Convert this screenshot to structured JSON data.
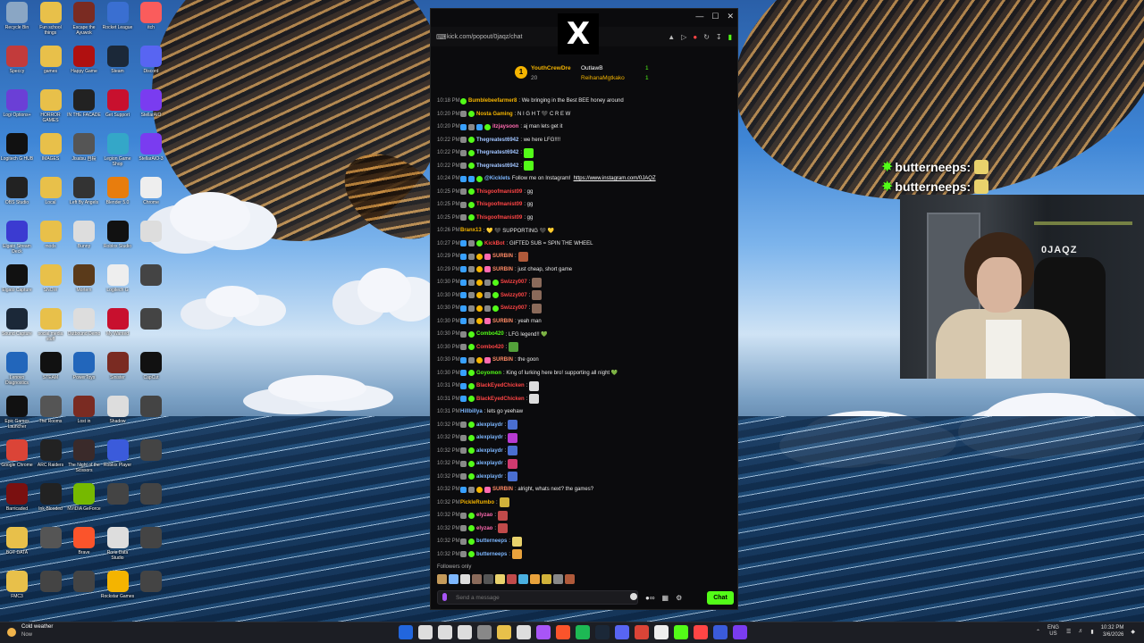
{
  "colors": {
    "kick_green": "#53fc18",
    "chat_bg": "#0b0b0d",
    "gold": "#f4b400"
  },
  "desktop_icons": [
    {
      "label": "Recycle Bin",
      "color": "#8aa6c4"
    },
    {
      "label": "Fun school things",
      "color": "#e8c04a"
    },
    {
      "label": "Escape the Ayuwok",
      "color": "#7a2b22"
    },
    {
      "label": "Rocket League",
      "color": "#3a6fd1"
    },
    {
      "label": "itch",
      "color": "#fa5c5c"
    },
    {
      "label": "Speccy",
      "color": "#c23b3b"
    },
    {
      "label": "games",
      "color": "#e8c04a"
    },
    {
      "label": "Happy Game",
      "color": "#b01010"
    },
    {
      "label": "Steam",
      "color": "#1b2838"
    },
    {
      "label": "Discord",
      "color": "#5865f2"
    },
    {
      "label": "Logi Options+",
      "color": "#6b3fd6"
    },
    {
      "label": "HORROR GAMES",
      "color": "#e8c04a"
    },
    {
      "label": "IN THE FACADE",
      "color": "#222"
    },
    {
      "label": "Get Support",
      "color": "#c8102e"
    },
    {
      "label": "StellarAIO",
      "color": "#7a3cf0"
    },
    {
      "label": "Logitech G HUB",
      "color": "#111"
    },
    {
      "label": "IMAGES",
      "color": "#e8c04a"
    },
    {
      "label": "Jisatsu 自殺",
      "color": "#555"
    },
    {
      "label": "Legion Game Shop",
      "color": "#34a7c8"
    },
    {
      "label": "StellarAIO-3",
      "color": "#7a3cf0"
    },
    {
      "label": "OBS Studio",
      "color": "#222"
    },
    {
      "label": "Local",
      "color": "#e8c04a"
    },
    {
      "label": "Left By Angels",
      "color": "#333"
    },
    {
      "label": "Blender 5.0",
      "color": "#e87d0d"
    },
    {
      "label": "Chrome",
      "color": "#eee"
    },
    {
      "label": "Elgato Stream Deck",
      "color": "#3b3bd1"
    },
    {
      "label": "mods",
      "color": "#e8c04a"
    },
    {
      "label": "Bunny",
      "color": "#ddd"
    },
    {
      "label": "Roblox Studio",
      "color": "#111"
    },
    {
      "label": "",
      "color": "#ddd"
    },
    {
      "label": "Elgato Capture",
      "color": "#111"
    },
    {
      "label": "SNOW",
      "color": "#e8c04a"
    },
    {
      "label": "Mortem",
      "color": "#5a3a1a"
    },
    {
      "label": "Logitech G",
      "color": "#eee"
    },
    {
      "label": "",
      "color": "#444"
    },
    {
      "label": "Sound Capture",
      "color": "#1b2838"
    },
    {
      "label": "social media stuff",
      "color": "#e8c04a"
    },
    {
      "label": "Outbound Demo",
      "color": "#ddd"
    },
    {
      "label": "My Wanted",
      "color": "#c8102e"
    },
    {
      "label": "",
      "color": "#444"
    },
    {
      "label": "Lenovo Diagnostics",
      "color": "#2266bb"
    },
    {
      "label": "STEAM",
      "color": "#111"
    },
    {
      "label": "PowerToys",
      "color": "#2266bb"
    },
    {
      "label": "Sinister",
      "color": "#7a2b22"
    },
    {
      "label": "CapCut",
      "color": "#111"
    },
    {
      "label": "Epic Games Launcher",
      "color": "#111"
    },
    {
      "label": "The Rooms",
      "color": "#555"
    },
    {
      "label": "Lost in",
      "color": "#7a2b22"
    },
    {
      "label": "Shadow",
      "color": "#ddd"
    },
    {
      "label": "",
      "color": "#444"
    },
    {
      "label": "Google Chrome",
      "color": "#db4437"
    },
    {
      "label": "ARC Raiders",
      "color": "#222"
    },
    {
      "label": "The Night of the Scissors",
      "color": "#3a2a2a"
    },
    {
      "label": "Roblox Player",
      "color": "#3b5bdb"
    },
    {
      "label": "",
      "color": "#444"
    },
    {
      "label": "Barricaded",
      "color": "#7a1010"
    },
    {
      "label": "Ink-Blooded",
      "color": "#222"
    },
    {
      "label": "NVIDIA GeForce",
      "color": "#76b900"
    },
    {
      "label": "",
      "color": "#444"
    },
    {
      "label": "",
      "color": "#444"
    },
    {
      "label": "BOT DATA",
      "color": "#e8c04a"
    },
    {
      "label": "",
      "color": "#555"
    },
    {
      "label": "Brave",
      "color": "#fb542b"
    },
    {
      "label": "Roris Data Studio",
      "color": "#ddd"
    },
    {
      "label": "",
      "color": "#444"
    },
    {
      "label": "FMC3",
      "color": "#e8c04a"
    },
    {
      "label": "",
      "color": "#444"
    },
    {
      "label": "",
      "color": "#444"
    },
    {
      "label": "Rockstar Games",
      "color": "#f4b400"
    },
    {
      "label": "",
      "color": "#444"
    }
  ],
  "browser": {
    "url": "kick.com/popout/0jaqz/chat",
    "x_logo": "X"
  },
  "pinned": {
    "rank": "1",
    "top_user": "YouthCrewDre",
    "top_count": "20",
    "user2": "OutlawB",
    "user2_count": "1",
    "user3": "ReihanaMgtkako",
    "user3_count": "1"
  },
  "messages": [
    {
      "time": "10:18 PM",
      "badges": [
        "green"
      ],
      "user": "Bumblebeefarmer8",
      "color": "#f4b400",
      "text": ": We bringing in the Best BEE honey around",
      "emotes": []
    },
    {
      "time": "10:20 PM",
      "badges": [
        "grey",
        "green"
      ],
      "user": "Nosta Gaming",
      "color": "#f4b400",
      "text": ": N I G H T 🖤 C R E W",
      "emotes": []
    },
    {
      "time": "10:20 PM",
      "badges": [
        "blue",
        "grey",
        "blue",
        "green"
      ],
      "user": "itzjaysoon",
      "color": "#ff6ab0",
      "text": ": aj man lets get it",
      "emotes": []
    },
    {
      "time": "10:22 PM",
      "badges": [
        "grey",
        "green"
      ],
      "user": "Thegreatest6942",
      "color": "#a0c4ff",
      "text": ": we here LFG!!!!",
      "emotes": []
    },
    {
      "time": "10:22 PM",
      "badges": [
        "grey",
        "green"
      ],
      "user": "Thegreatest6942",
      "color": "#a0c4ff",
      "text": ":",
      "emotes": [
        "#53fc18"
      ]
    },
    {
      "time": "10:22 PM",
      "badges": [
        "grey",
        "green"
      ],
      "user": "Thegreatest6942",
      "color": "#a0c4ff",
      "text": ":",
      "emotes": [
        "#53fc18"
      ]
    },
    {
      "time": "10:24 PM",
      "badges": [
        "blue",
        "blue",
        "green"
      ],
      "user": "@Kicklets",
      "color": "#7db7ff",
      "text": " Follow me on Instagram!",
      "link": "https://www.instagram.com/0JAQZ",
      "emotes": []
    },
    {
      "time": "10:25 PM",
      "badges": [
        "grey",
        "green"
      ],
      "user": "Thisgoofmanist09",
      "color": "#ff4545",
      "text": ": gg",
      "emotes": []
    },
    {
      "time": "10:25 PM",
      "badges": [
        "grey",
        "green"
      ],
      "user": "Thisgoofmanist09",
      "color": "#ff4545",
      "text": ": gg",
      "emotes": []
    },
    {
      "time": "10:25 PM",
      "badges": [
        "grey",
        "green"
      ],
      "user": "Thisgoofmanist09",
      "color": "#ff4545",
      "text": ": gg",
      "emotes": []
    },
    {
      "time": "10:26 PM",
      "badges": [],
      "user": "Branx13",
      "color": "#f4b400",
      "text": ": 💛 🖤 SUPPORTING 🖤 💛",
      "emotes": []
    },
    {
      "time": "10:27 PM",
      "badges": [
        "blue",
        "grey",
        "green"
      ],
      "user": "KickBot",
      "color": "#ff4545",
      "text": ": GIFTED SUB = SPIN THE WHEEL",
      "emotes": []
    },
    {
      "time": "10:29 PM",
      "badges": [
        "blue",
        "grey",
        "orange",
        "pink"
      ],
      "user": "SURBIN",
      "color": "#ff8a65",
      "text": ":",
      "emotes": [
        "#b05a3a"
      ]
    },
    {
      "time": "10:29 PM",
      "badges": [
        "blue",
        "grey",
        "orange",
        "pink"
      ],
      "user": "SURBIN",
      "color": "#ff8a65",
      "text": ": just cheap, short game",
      "emotes": []
    },
    {
      "time": "10:30 PM",
      "badges": [
        "blue",
        "grey",
        "orange",
        "grey",
        "green"
      ],
      "user": "Swizzy007",
      "color": "#ff4545",
      "text": ":",
      "emotes": [
        "#8a6a5a"
      ]
    },
    {
      "time": "10:30 PM",
      "badges": [
        "blue",
        "grey",
        "orange",
        "grey",
        "green"
      ],
      "user": "Swizzy007",
      "color": "#ff4545",
      "text": ":",
      "emotes": [
        "#8a6a5a"
      ]
    },
    {
      "time": "10:30 PM",
      "badges": [
        "blue",
        "grey",
        "orange",
        "grey",
        "green"
      ],
      "user": "Swizzy007",
      "color": "#ff4545",
      "text": ":",
      "emotes": [
        "#8a6a5a"
      ]
    },
    {
      "time": "10:30 PM",
      "badges": [
        "blue",
        "grey",
        "orange",
        "pink"
      ],
      "user": "SURBIN",
      "color": "#ff8a65",
      "text": ": yeah man",
      "emotes": []
    },
    {
      "time": "10:30 PM",
      "badges": [
        "grey",
        "green"
      ],
      "user": "Combo420",
      "color": "#53fc18",
      "text": ": LFG legend!! 💚",
      "emotes": []
    },
    {
      "time": "10:30 PM",
      "badges": [
        "grey",
        "green"
      ],
      "user": "Combo420",
      "color": "#ff4545",
      "text": ":",
      "emotes": [
        "#53a03a"
      ]
    },
    {
      "time": "10:30 PM",
      "badges": [
        "blue",
        "grey",
        "orange",
        "pink"
      ],
      "user": "SURBIN",
      "color": "#ff8a65",
      "text": ": the goon",
      "emotes": []
    },
    {
      "time": "10:30 PM",
      "badges": [
        "blue",
        "green"
      ],
      "user": "Goyomon",
      "color": "#53fc18",
      "text": ": King of lurking here bro! supporting all night 💚",
      "emotes": []
    },
    {
      "time": "10:31 PM",
      "badges": [
        "blue",
        "green"
      ],
      "user": "BlackEyedChicken",
      "color": "#ff4545",
      "text": ":",
      "emotes": [
        "#ddd"
      ]
    },
    {
      "time": "10:31 PM",
      "badges": [
        "blue",
        "green"
      ],
      "user": "BlackEyedChicken",
      "color": "#ff4545",
      "text": ":",
      "emotes": [
        "#ddd"
      ]
    },
    {
      "time": "10:31 PM",
      "badges": [],
      "user": "Hillbillya",
      "color": "#7db7ff",
      "text": ": lets go yeehaw",
      "emotes": []
    },
    {
      "time": "10:32 PM",
      "badges": [
        "grey",
        "green"
      ],
      "user": "alexplaydr",
      "color": "#7db7ff",
      "text": ":",
      "emotes": [
        "#4a6fd1"
      ]
    },
    {
      "time": "10:32 PM",
      "badges": [
        "grey",
        "green"
      ],
      "user": "alexplaydr",
      "color": "#7db7ff",
      "text": ":",
      "emotes": [
        "#b83ad1"
      ]
    },
    {
      "time": "10:32 PM",
      "badges": [
        "grey",
        "green"
      ],
      "user": "alexplaydr",
      "color": "#7db7ff",
      "text": ":",
      "emotes": [
        "#4a6fd1"
      ]
    },
    {
      "time": "10:32 PM",
      "badges": [
        "grey",
        "green"
      ],
      "user": "alexplaydr",
      "color": "#7db7ff",
      "text": ":",
      "emotes": [
        "#d13a6f"
      ]
    },
    {
      "time": "10:32 PM",
      "badges": [
        "grey",
        "green"
      ],
      "user": "alexplaydr",
      "color": "#7db7ff",
      "text": ":",
      "emotes": [
        "#4a6fd1"
      ]
    },
    {
      "time": "10:32 PM",
      "badges": [
        "blue",
        "grey",
        "orange",
        "pink"
      ],
      "user": "SURBIN",
      "color": "#ff8a65",
      "text": ": alright, whats next? the games?",
      "emotes": []
    },
    {
      "time": "10:32 PM",
      "badges": [],
      "user": "PickleRumbo",
      "color": "#f4b400",
      "text": ":",
      "emotes": [
        "#d1b23a"
      ]
    },
    {
      "time": "10:32 PM",
      "badges": [
        "grey",
        "green"
      ],
      "user": "elyzao",
      "color": "#ff6ab0",
      "text": ":",
      "emotes": [
        "#c04a4a"
      ]
    },
    {
      "time": "10:32 PM",
      "badges": [
        "grey",
        "green"
      ],
      "user": "elyzao",
      "color": "#ff6ab0",
      "text": ":",
      "emotes": [
        "#c04a4a"
      ]
    },
    {
      "time": "10:32 PM",
      "badges": [
        "grey",
        "green"
      ],
      "user": "butterneeps",
      "color": "#7db7ff",
      "text": ":",
      "emotes": [
        "#e9d26c"
      ]
    },
    {
      "time": "10:32 PM",
      "badges": [
        "grey",
        "green"
      ],
      "user": "butterneeps",
      "color": "#7db7ff",
      "text": ":",
      "emotes": [
        "#e9a23c"
      ]
    }
  ],
  "chat_footer": {
    "followers_only": "Followers only",
    "placeholder": "Send a message",
    "chat_button": "Chat",
    "emote_colors": [
      "#c49a5a",
      "#7db7ff",
      "#ddd",
      "#8a6a5a",
      "#555",
      "#e9d26c",
      "#c04a4a",
      "#4ab0e0",
      "#e9a23c",
      "#d1b23a",
      "#888",
      "#b05a3a"
    ]
  },
  "stream_overlay": {
    "messages": [
      {
        "user": "butterneeps:"
      },
      {
        "user": "butterneeps:"
      }
    ],
    "cam_logo": "0JAQZ"
  },
  "taskbar": {
    "weather_temp": "Cold weather",
    "weather_sub": "Now",
    "lang_top": "ENG",
    "lang_bottom": "US",
    "time": "10:32 PM",
    "date": "3/6/2026",
    "app_colors": [
      "#2266dd",
      "#ddd",
      "#ddd",
      "#ddd",
      "#888",
      "#e8c04a",
      "#ddd",
      "#a855f7",
      "#fb542b",
      "#1db954",
      "#1b2838",
      "#5865f2",
      "#db4437",
      "#eee",
      "#53fc18",
      "#ff4545",
      "#3b5bdb",
      "#7a3cf0"
    ]
  }
}
